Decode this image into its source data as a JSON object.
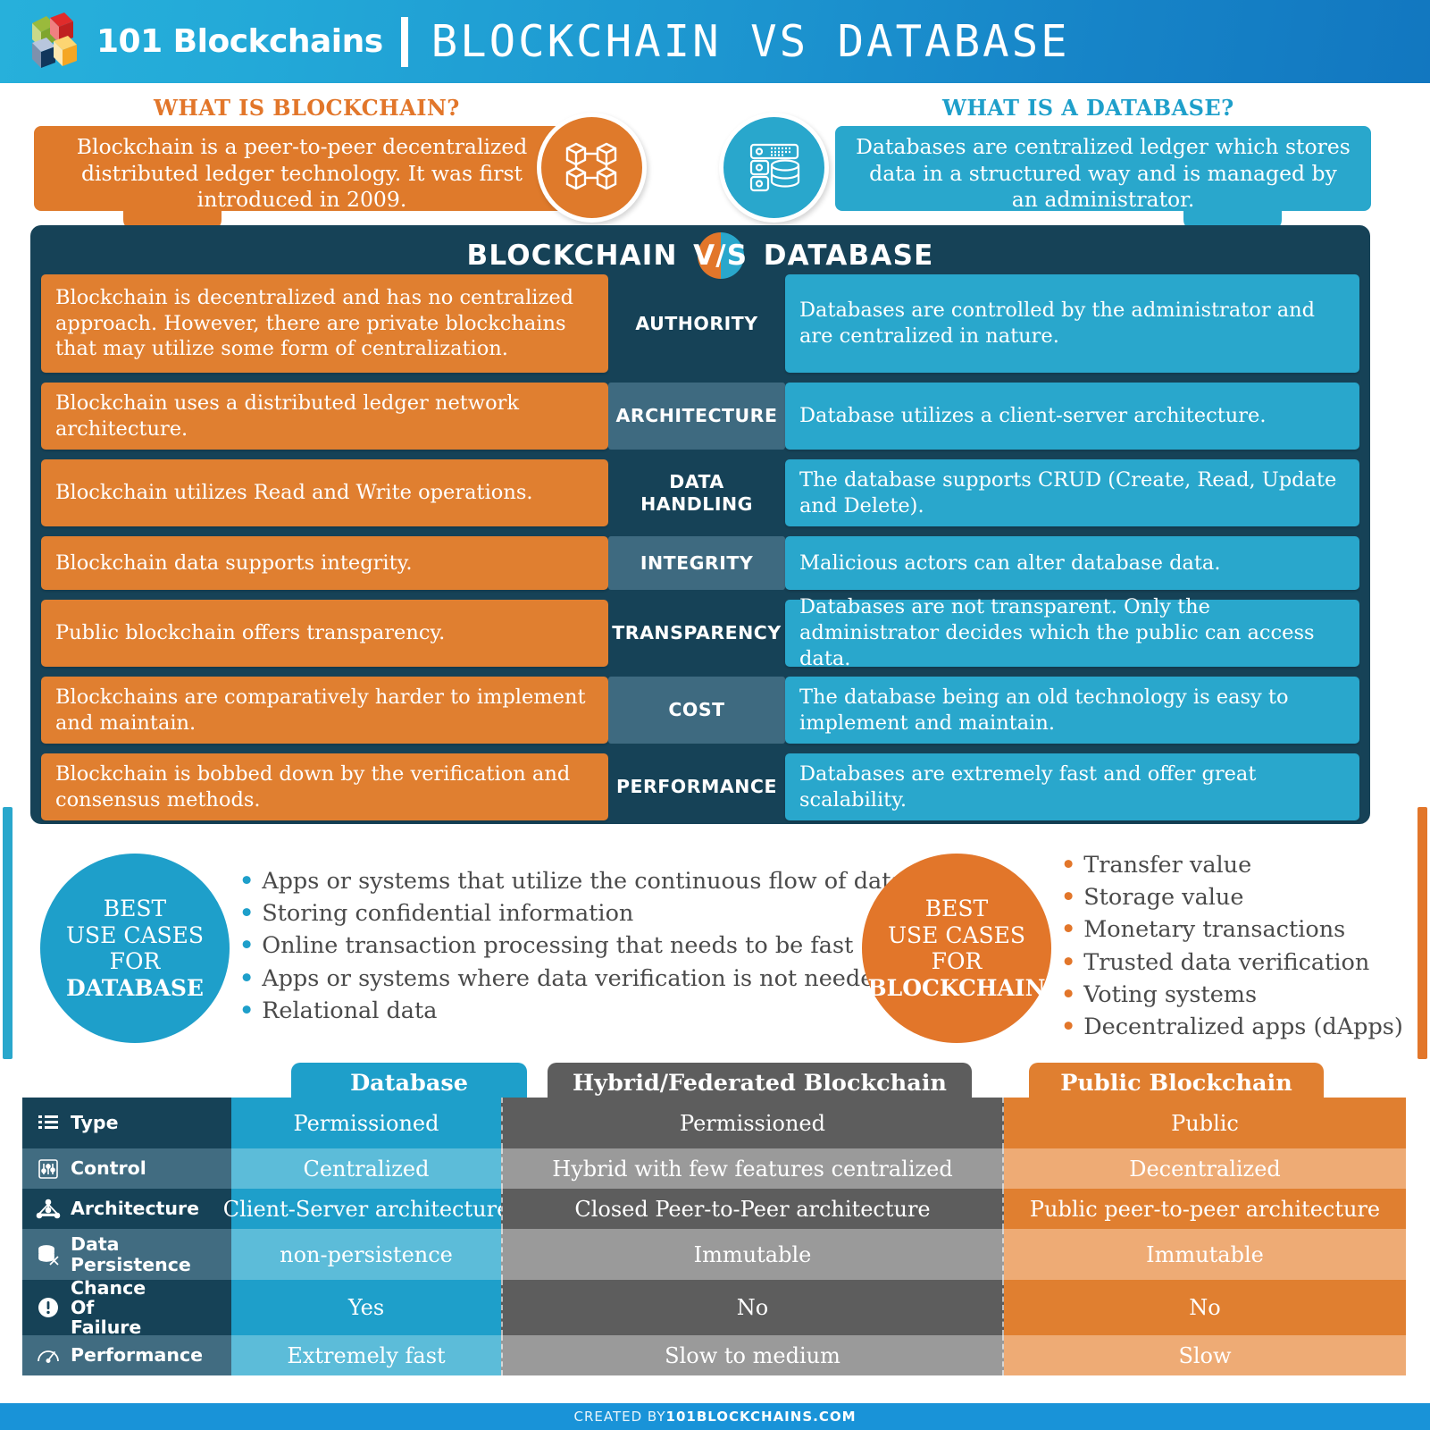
{
  "header": {
    "brand": "101 Blockchains",
    "title": "BLOCKCHAIN VS DATABASE"
  },
  "intro": {
    "blockchain_label": "WHAT IS BLOCKCHAIN?",
    "blockchain_text": "Blockchain is a peer-to-peer decentralized distributed ledger technology. It was first introduced in 2009.",
    "database_label": "WHAT IS A DATABASE?",
    "database_text": "Databases are centralized ledger which stores data in a structured way and is managed by an administrator."
  },
  "comparison": {
    "heading_left": "BLOCKCHAIN",
    "heading_vs": "V/S",
    "heading_right": "DATABASE",
    "rows": [
      {
        "attribute": "AUTHORITY",
        "blockchain": "Blockchain is decentralized and has no centralized approach. However, there are private blockchains that may utilize some form of centralization.",
        "database": "Databases are controlled by the administrator and are centralized in nature."
      },
      {
        "attribute": "ARCHITECTURE",
        "blockchain": "Blockchain uses a distributed ledger network architecture.",
        "database": "Database utilizes a client-server architecture."
      },
      {
        "attribute": "DATA HANDLING",
        "blockchain": "Blockchain utilizes Read and Write operations.",
        "database": "The database supports CRUD (Create, Read, Update and Delete)."
      },
      {
        "attribute": "INTEGRITY",
        "blockchain": "Blockchain data supports integrity.",
        "database": "Malicious actors can alter database data."
      },
      {
        "attribute": "TRANSPARENCY",
        "blockchain": "Public blockchain offers transparency.",
        "database": "Databases are not transparent. Only the administrator decides which the public can access data."
      },
      {
        "attribute": "COST",
        "blockchain": "Blockchains are comparatively harder to implement and maintain.",
        "database": "The database being an old technology is easy to implement and maintain."
      },
      {
        "attribute": "PERFORMANCE",
        "blockchain": "Blockchain is bobbed down by the verification and consensus methods.",
        "database": "Databases are extremely fast and offer great scalability."
      }
    ]
  },
  "use_cases": {
    "database": {
      "title_line1": "BEST",
      "title_line2": "USE CASES",
      "title_line3": "FOR",
      "title_line4": "DATABASE",
      "items": [
        "Apps or systems that utilize the continuous flow of data",
        "Storing confidential information",
        "Online transaction processing that needs to be fast",
        "Apps or systems where data verification is not needed",
        "Relational data"
      ]
    },
    "blockchain": {
      "title_line1": "BEST",
      "title_line2": "USE CASES",
      "title_line3": "FOR",
      "title_line4": "BLOCKCHAIN",
      "items": [
        "Transfer value",
        "Storage value",
        "Monetary transactions",
        "Trusted data verification",
        "Voting systems",
        "Decentralized apps (dApps)"
      ]
    }
  },
  "matrix": {
    "columns": [
      "Database",
      "Hybrid/Federated Blockchain",
      "Public Blockchain"
    ],
    "rows": [
      {
        "label": "Type",
        "icon": "list-icon",
        "values": [
          "Permissioned",
          "Permissioned",
          "Public"
        ]
      },
      {
        "label": "Control",
        "icon": "sliders-icon",
        "values": [
          "Centralized",
          "Hybrid with few features centralized",
          "Decentralized"
        ]
      },
      {
        "label": "Architecture",
        "icon": "network-icon",
        "values": [
          "Client-Server architecture",
          "Closed Peer-to-Peer architecture",
          "Public peer-to-peer architecture"
        ]
      },
      {
        "label": "Data Persistence",
        "icon": "database-stack-icon",
        "values": [
          "non-persistence",
          "Immutable",
          "Immutable"
        ]
      },
      {
        "label": "Chance Of Failure",
        "icon": "alert-icon",
        "values": [
          "Yes",
          "No",
          "No"
        ]
      },
      {
        "label": "Performance",
        "icon": "speedometer-icon",
        "values": [
          "Extremely fast",
          "Slow to medium",
          "Slow"
        ]
      }
    ]
  },
  "footer": {
    "prefix": "CREATED BY ",
    "site": "101BLOCKCHAINS.COM"
  },
  "colors": {
    "orange": "#e07f30",
    "blue": "#29a7cc",
    "dark_navy": "#164257",
    "gray": "#5d5d5d",
    "header_blue": "#1993d8"
  }
}
